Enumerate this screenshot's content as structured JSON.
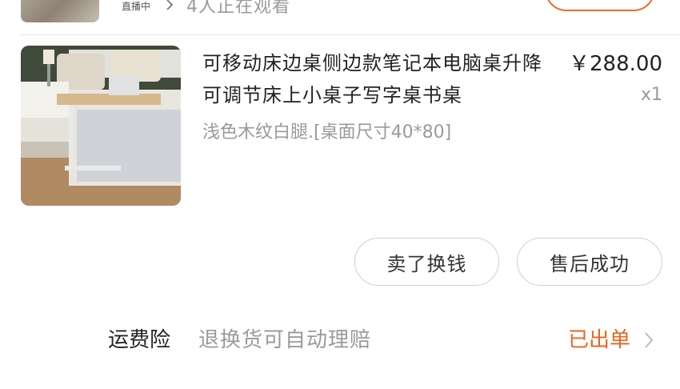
{
  "top_row": {
    "live_label": "直播中",
    "watching_text": "4人正在观看"
  },
  "product": {
    "title": "可移动床边桌侧边款笔记本电脑桌升降可调节床上小桌子写字桌书桌",
    "spec": "浅色木纹白腿.[桌面尺寸40*80]",
    "price": "￥288.00",
    "quantity": "x1"
  },
  "actions": {
    "sell_label": "卖了换钱",
    "after_sales_label": "售后成功"
  },
  "insurance": {
    "label": "运费险",
    "description": "退换货可自动理赔",
    "status": "已出单"
  },
  "colors": {
    "accent": "#e8651e",
    "muted_text": "#9a9a9a",
    "border": "#cfcfcf"
  }
}
